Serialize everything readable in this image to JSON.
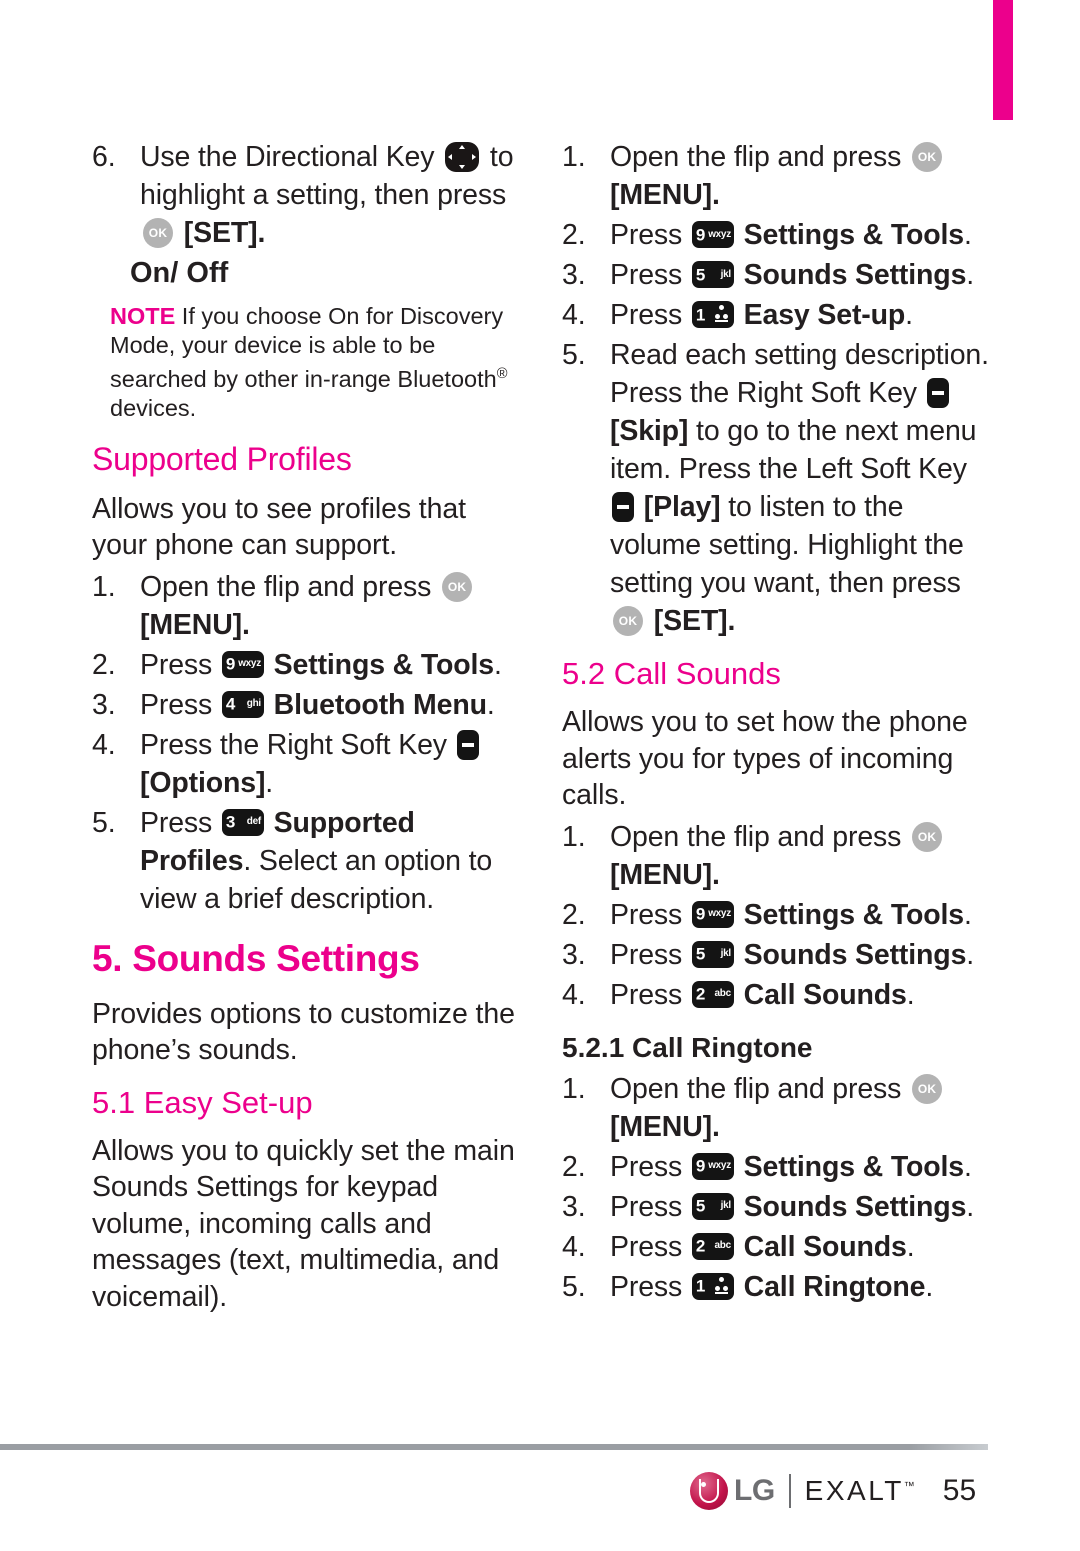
{
  "page": {
    "number": "55",
    "accent_color": "#ec008c",
    "text_color": "#231f20"
  },
  "left_column": {
    "step6": {
      "num": "6.",
      "text_a": "Use the Directional Key",
      "text_b": "to",
      "text_c": "highlight a setting, then press",
      "text_d": "[SET]."
    },
    "onoff_heading": "On/ Off",
    "note": {
      "label": "NOTE",
      "text": " If you choose On for Discovery Mode, your device is able to be searched by other in-range Bluetooth",
      "sup": "®",
      "text_tail": " devices."
    },
    "supported_profiles_heading": "Supported Profiles",
    "supported_profiles_body": "Allows you to see profiles that your phone can support.",
    "supported_profiles_steps": [
      {
        "num": "1.",
        "pre": "Open the flip and press",
        "key": "ok",
        "post": "",
        "bold": "[MENU]."
      },
      {
        "num": "2.",
        "pre": "Press",
        "key": "9wxyz",
        "bold": "Settings & Tools",
        "post": "."
      },
      {
        "num": "3.",
        "pre": "Press",
        "key": "4ghi",
        "bold": "Bluetooth Menu",
        "post": "."
      },
      {
        "num": "4.",
        "pre": "Press the Right Soft Key",
        "key": "soft",
        "bold": "[Options]",
        "post": "."
      },
      {
        "num": "5.",
        "pre": "Press",
        "key": "3def",
        "bold": "Supported Profiles",
        "post": ". Select an option to view a brief description."
      }
    ],
    "sounds_settings_heading": "5. Sounds Settings",
    "sounds_settings_body": "Provides options to customize the phone’s sounds.",
    "easy_setup_heading": "5.1 Easy Set-up",
    "easy_setup_body": "Allows you to quickly set the main Sounds Settings for keypad volume, incoming calls and messages (text, multimedia, and voicemail)."
  },
  "right_column": {
    "easy_setup_steps": [
      {
        "num": "1.",
        "pre": "Open the flip and press",
        "key": "ok",
        "bold": "[MENU]."
      },
      {
        "num": "2.",
        "pre": "Press",
        "key": "9wxyz",
        "bold": "Settings & Tools",
        "post": "."
      },
      {
        "num": "3.",
        "pre": "Press",
        "key": "5jkl",
        "bold": "Sounds Settings",
        "post": "."
      },
      {
        "num": "4.",
        "pre": "Press",
        "key": "1vm",
        "bold": "Easy Set-up",
        "post": "."
      }
    ],
    "step5": {
      "num": "5.",
      "t1": "Read each setting description. Press the Right Soft Key",
      "b1": "[Skip]",
      "t2": " to go to the next menu item. Press the Left Soft Key",
      "b2": "[Play]",
      "t3": " to listen to the volume setting. Highlight the setting you want, then press",
      "b3": "[SET]."
    },
    "call_sounds_heading": "5.2 Call Sounds",
    "call_sounds_body": "Allows you to set how the phone alerts you for types of incoming calls.",
    "call_sounds_steps": [
      {
        "num": "1.",
        "pre": "Open the flip and press",
        "key": "ok",
        "bold": "[MENU]."
      },
      {
        "num": "2.",
        "pre": "Press",
        "key": "9wxyz",
        "bold": "Settings & Tools",
        "post": "."
      },
      {
        "num": "3.",
        "pre": "Press",
        "key": "5jkl",
        "bold": "Sounds Settings",
        "post": "."
      },
      {
        "num": "4.",
        "pre": "Press",
        "key": "2abc",
        "bold": "Call Sounds",
        "post": "."
      }
    ],
    "call_ringtone_heading": "5.2.1 Call Ringtone",
    "call_ringtone_steps": [
      {
        "num": "1.",
        "pre": "Open the flip and press",
        "key": "ok",
        "bold": "[MENU]."
      },
      {
        "num": "2.",
        "pre": "Press",
        "key": "9wxyz",
        "bold": "Settings & Tools",
        "post": "."
      },
      {
        "num": "3.",
        "pre": "Press",
        "key": "5jkl",
        "bold": "Sounds Settings",
        "post": "."
      },
      {
        "num": "4.",
        "pre": "Press",
        "key": "2abc",
        "bold": "Call Sounds",
        "post": "."
      },
      {
        "num": "5.",
        "pre": "Press",
        "key": "1vm",
        "bold": "Call Ringtone",
        "post": "."
      }
    ]
  },
  "keys": {
    "ok": {
      "icon": "ok-key-icon",
      "label": "OK"
    },
    "dir": {
      "icon": "directional-key-icon"
    },
    "soft": {
      "icon": "soft-key-icon"
    },
    "1vm": {
      "icon": "keypad-1-icon",
      "number": "1",
      "letters": ""
    },
    "2abc": {
      "icon": "keypad-2-icon",
      "number": "2",
      "letters": "abc"
    },
    "3def": {
      "icon": "keypad-3-icon",
      "number": "3",
      "letters": "def"
    },
    "4ghi": {
      "icon": "keypad-4-icon",
      "number": "4",
      "letters": "ghi"
    },
    "5jkl": {
      "icon": "keypad-5-icon",
      "number": "5",
      "letters": "jkl"
    },
    "9wxyz": {
      "icon": "keypad-9-icon",
      "number": "9",
      "letters": "wxyz"
    }
  },
  "footer": {
    "brand": "LG",
    "product": "EXALT",
    "tm": "™",
    "page_number": "55"
  }
}
